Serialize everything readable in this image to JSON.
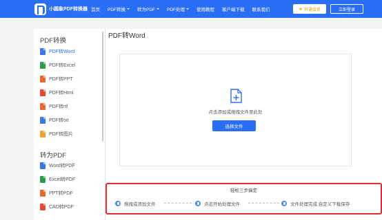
{
  "header": {
    "logo_text": "小圆象PDF转换器",
    "nav": [
      {
        "label": "首页",
        "has_caret": false
      },
      {
        "label": "PDF转换",
        "has_caret": true
      },
      {
        "label": "转为PDF",
        "has_caret": true
      },
      {
        "label": "PDF处理",
        "has_caret": true
      },
      {
        "label": "使用教程",
        "has_caret": false
      },
      {
        "label": "客户端下载",
        "has_caret": false
      },
      {
        "label": "联系我们",
        "has_caret": false
      }
    ],
    "vip_label": "开通会员",
    "login_label": "立即登录",
    "accent_color": "#2b6ef6"
  },
  "sidebar": {
    "section1_title": "PDF转换",
    "section1_items": [
      {
        "label": "PDF转Word",
        "icon": "word-file-icon",
        "color": "#3b78e7",
        "active": true
      },
      {
        "label": "PDF转Excel",
        "icon": "excel-file-icon",
        "color": "#2a9d4a",
        "active": false
      },
      {
        "label": "PDF转PPT",
        "icon": "ppt-file-icon",
        "color": "#e8692c",
        "active": false
      },
      {
        "label": "PDF转Html",
        "icon": "html-file-icon",
        "color": "#e5492f",
        "active": false
      },
      {
        "label": "PDF转rtf",
        "icon": "rtf-file-icon",
        "color": "#e8692c",
        "active": false
      },
      {
        "label": "PDF转txt",
        "icon": "txt-file-icon",
        "color": "#3b78e7",
        "active": false
      },
      {
        "label": "PDF转图片",
        "icon": "image-file-icon",
        "color": "#f0a22e",
        "active": false
      }
    ],
    "section2_title": "转为PDF",
    "section2_items": [
      {
        "label": "Word转PDF",
        "icon": "word-file-icon",
        "color": "#3b78e7"
      },
      {
        "label": "Excel转PDF",
        "icon": "excel-file-icon",
        "color": "#2a9d4a"
      },
      {
        "label": "PPT转PDF",
        "icon": "ppt-file-icon",
        "color": "#e8692c"
      },
      {
        "label": "CAD转PDF",
        "icon": "cad-file-icon",
        "color": "#e5492f"
      }
    ]
  },
  "main": {
    "title": "PDF转Word",
    "drop_hint": "点击添加或拖拽文件至此处",
    "choose_button": "选择文件",
    "steps_title": "轻松三步搞定",
    "steps": [
      {
        "label": "拖拽或添加文件",
        "icon": "upload-step-icon"
      },
      {
        "label": "点击开始处理文件",
        "icon": "process-step-icon"
      },
      {
        "label": "文件处理完成 自定义下载保存",
        "icon": "download-step-icon"
      }
    ]
  }
}
